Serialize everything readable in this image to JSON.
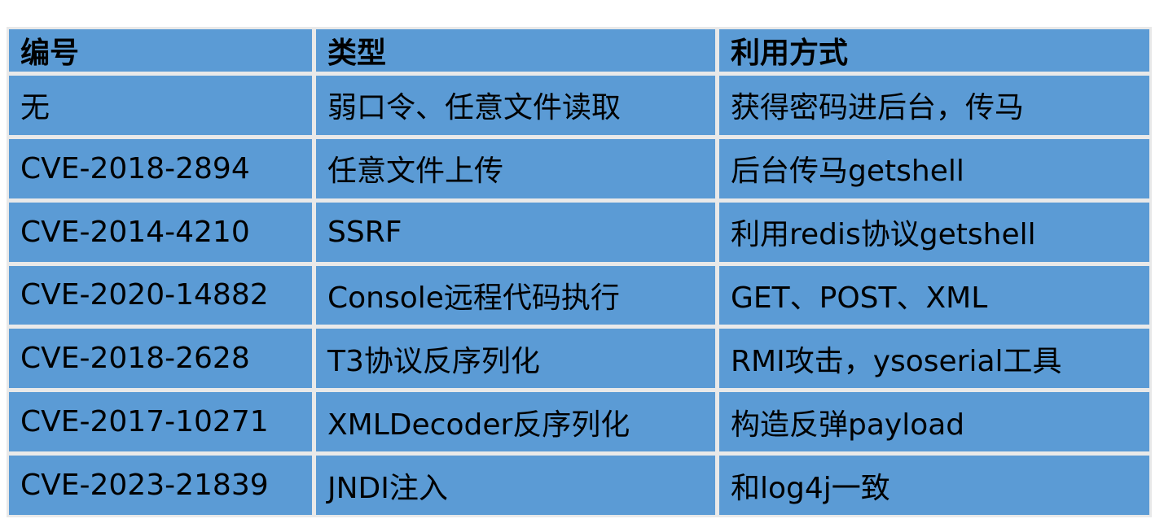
{
  "table": {
    "headers": [
      "编号",
      "类型",
      "利用方式"
    ],
    "rows": [
      [
        "无",
        "弱口令、任意文件读取",
        "获得密码进后台，传马"
      ],
      [
        "CVE-2018-2894",
        "任意文件上传",
        "后台传马getshell"
      ],
      [
        "CVE-2014-4210",
        "SSRF",
        "利用redis协议getshell"
      ],
      [
        "CVE-2020-14882",
        "Console远程代码执行",
        "GET、POST、XML"
      ],
      [
        "CVE-2018-2628",
        "T3协议反序列化",
        "RMI攻击，ysoserial工具"
      ],
      [
        "CVE-2017-10271",
        "XMLDecoder反序列化",
        "构造反弹payload"
      ],
      [
        "CVE-2023-21839",
        "JNDI注入",
        "和log4j一致"
      ]
    ]
  },
  "colors": {
    "cell_bg": "#5b9bd5",
    "grid_line": "#e9e9e9",
    "text": "#000000"
  }
}
